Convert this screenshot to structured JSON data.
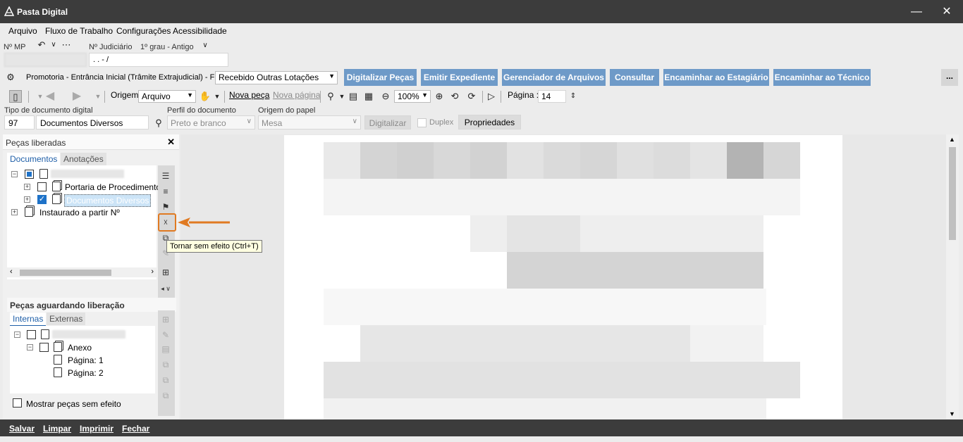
{
  "app": {
    "title": "Pasta Digital"
  },
  "menu": [
    "Arquivo",
    "Fluxo de Trabalho",
    "Configurações",
    "Acessibilidade"
  ],
  "mp": {
    "label": "Nº MP",
    "judicial_label": "Nº Judiciário",
    "grau": "1º grau - Antigo",
    "judicial_value": ". .      - /"
  },
  "fila": {
    "label": "Promotoria - Entrância Inicial (Trâmite Extrajudicial) - Fila",
    "value": "Recebido Outras Lotações",
    "buttons": [
      "Digitalizar Peças",
      "Emitir Expediente",
      "Gerenciador de Arquivos",
      "Consultar",
      "Encaminhar ao Estagiário",
      "Encaminhar ao Técnico"
    ],
    "more": "..."
  },
  "toolbar": {
    "origem_label": "Origem",
    "origem_value": "Arquivo",
    "nova_peca": "Nova peça",
    "nova_pagina": "Nova página",
    "zoom": "100%",
    "pagina_label": "Página :",
    "pagina_value": "14"
  },
  "doc": {
    "tipo_label": "Tipo de documento digital",
    "tipo_code": "97",
    "tipo_value": "Documentos Diversos",
    "perfil_label": "Perfil do documento",
    "perfil_value": "Preto e branco",
    "origem_papel_label": "Origem do papel",
    "origem_papel_value": "Mesa",
    "digitalizar": "Digitalizar",
    "duplex": "Duplex",
    "propriedades": "Propriedades"
  },
  "pecas_liberadas": {
    "title": "Peças liberadas",
    "tabs": [
      "Documentos",
      "Anotações"
    ],
    "tree": [
      "Portaria de Procedimento",
      "Documentos Diversos",
      "Instaurado a partir Nº"
    ]
  },
  "pecas_aguardando": {
    "title": "Peças aguardando liberação",
    "tabs": [
      "Internas",
      "Externas"
    ],
    "tree": [
      "Anexo",
      "Página: 1",
      "Página: 2"
    ],
    "mostrar": "Mostrar peças sem efeito"
  },
  "tooltip": "Tornar sem efeito (Ctrl+T)",
  "status": [
    "Salvar",
    "Limpar",
    "Imprimir",
    "Fechar"
  ],
  "colors": {
    "accent": "#6e9ac8",
    "titlebar": "#3c3c3c",
    "highlight": "#e07a22"
  }
}
